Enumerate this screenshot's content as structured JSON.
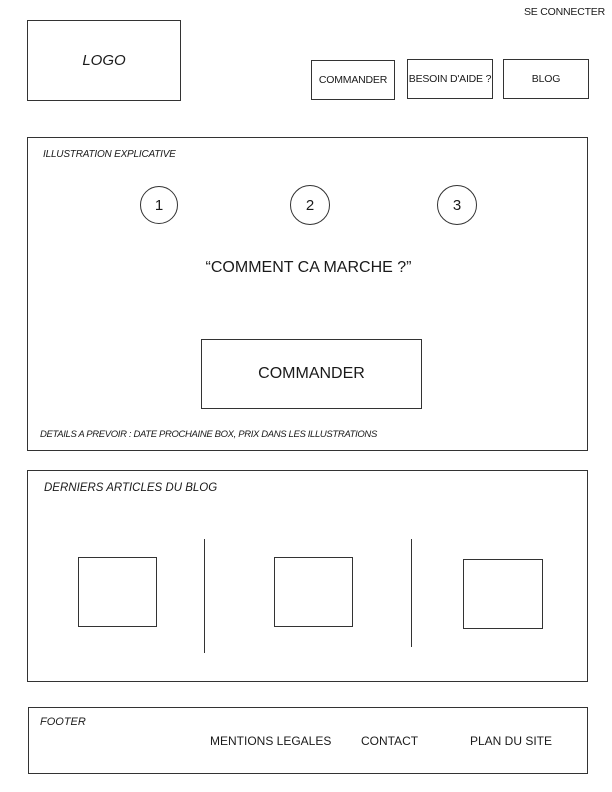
{
  "header": {
    "login_label": "SE CONNECTER",
    "logo_label": "LOGO",
    "nav": [
      {
        "label": "COMMANDER"
      },
      {
        "label": "BESOIN D'AIDE ?"
      },
      {
        "label": "BLOG"
      }
    ]
  },
  "illustration": {
    "section_label": "ILLUSTRATION EXPLICATIVE",
    "steps": [
      "1",
      "2",
      "3"
    ],
    "headline": "“COMMENT CA MARCHE ?”",
    "cta_label": "COMMANDER",
    "details_note": "DETAILS A PREVOIR : DATE PROCHAINE BOX, PRIX DANS LES ILLUSTRATIONS"
  },
  "blog": {
    "section_label": "DERNIERS ARTICLES DU BLOG"
  },
  "footer": {
    "label": "FOOTER",
    "links": [
      {
        "label": "MENTIONS LEGALES"
      },
      {
        "label": "CONTACT"
      },
      {
        "label": "PLAN DU SITE"
      }
    ]
  }
}
